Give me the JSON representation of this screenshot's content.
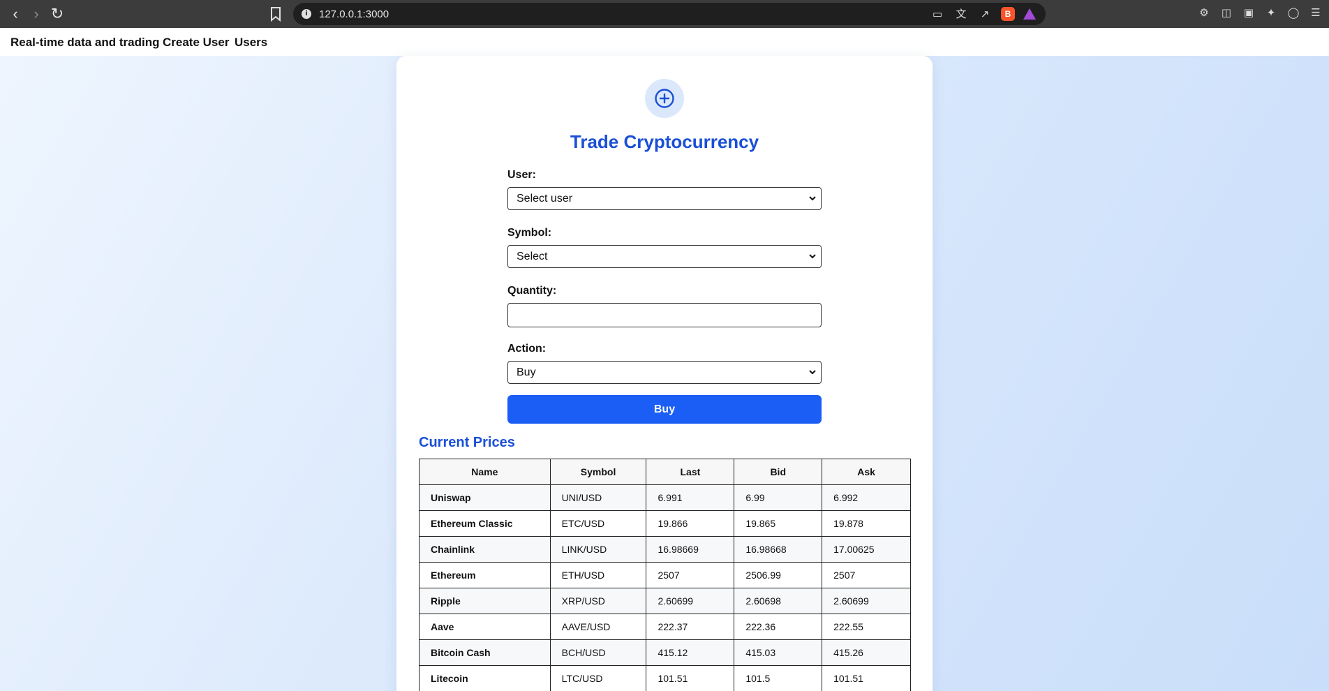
{
  "browser": {
    "url": "127.0.0.1:3000"
  },
  "nav": {
    "items": [
      "Real-time data and trading",
      "Create User",
      "Users"
    ]
  },
  "form": {
    "title": "Trade Cryptocurrency",
    "user_label": "User:",
    "user_value": "Select user",
    "symbol_label": "Symbol:",
    "symbol_value": "Select",
    "quantity_label": "Quantity:",
    "quantity_value": "",
    "action_label": "Action:",
    "action_value": "Buy",
    "submit_label": "Buy"
  },
  "prices": {
    "title": "Current Prices",
    "headers": [
      "Name",
      "Symbol",
      "Last",
      "Bid",
      "Ask"
    ],
    "rows": [
      {
        "name": "Uniswap",
        "symbol": "UNI/USD",
        "last": "6.991",
        "bid": "6.99",
        "ask": "6.992"
      },
      {
        "name": "Ethereum Classic",
        "symbol": "ETC/USD",
        "last": "19.866",
        "bid": "19.865",
        "ask": "19.878"
      },
      {
        "name": "Chainlink",
        "symbol": "LINK/USD",
        "last": "16.98669",
        "bid": "16.98668",
        "ask": "17.00625"
      },
      {
        "name": "Ethereum",
        "symbol": "ETH/USD",
        "last": "2507",
        "bid": "2506.99",
        "ask": "2507"
      },
      {
        "name": "Ripple",
        "symbol": "XRP/USD",
        "last": "2.60699",
        "bid": "2.60698",
        "ask": "2.60699"
      },
      {
        "name": "Aave",
        "symbol": "AAVE/USD",
        "last": "222.37",
        "bid": "222.36",
        "ask": "222.55"
      },
      {
        "name": "Bitcoin Cash",
        "symbol": "BCH/USD",
        "last": "415.12",
        "bid": "415.03",
        "ask": "415.26"
      },
      {
        "name": "Litecoin",
        "symbol": "LTC/USD",
        "last": "101.51",
        "bid": "101.5",
        "ask": "101.51"
      }
    ]
  },
  "colors": {
    "accent": "#1a4fd6",
    "button": "#1a5ef5"
  },
  "icons": {
    "back": "chevron-left-icon",
    "forward": "chevron-right-icon",
    "reload": "reload-icon",
    "bookmark": "bookmark-icon",
    "add": "plus-circle-icon"
  }
}
